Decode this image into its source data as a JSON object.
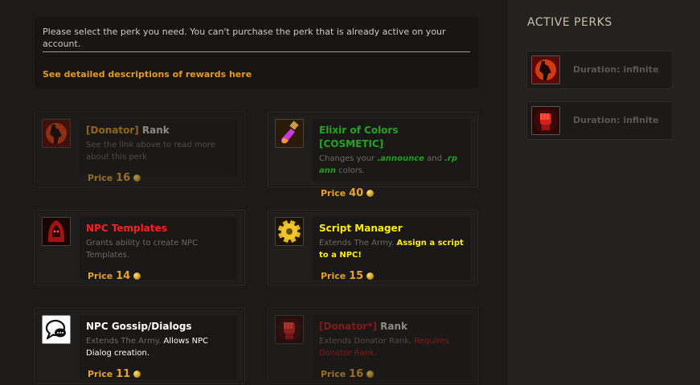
{
  "notice": {
    "text": "Please select the perk you need. You can't purchase the perk that is already active on your account.",
    "link": "See detailed descriptions of rewards here"
  },
  "perks": [
    {
      "title_parts": [
        "[Donator]",
        " Rank"
      ],
      "desc": "See the link above to read more about this perk",
      "price_label": "Price",
      "price": "16",
      "icon": "donator-silhouette-icon"
    },
    {
      "title_parts": [
        "Elixir of Colors",
        "[COSMETIC]"
      ],
      "desc_parts": [
        "Changes your ",
        ".announce",
        " and ",
        ".rp ann",
        " colors."
      ],
      "price_label": "Price",
      "price": "40",
      "icon": "potion-vial-icon"
    },
    {
      "title": "NPC Templates",
      "desc": "Grants ability to create NPC Templates.",
      "price_label": "Price",
      "price": "14",
      "icon": "hooded-figure-icon"
    },
    {
      "title": "Script Manager",
      "desc_parts": [
        "Extends The Army. ",
        "Assign a script to a NPC!"
      ],
      "price_label": "Price",
      "price": "15",
      "icon": "gear-icon"
    },
    {
      "title": "NPC Gossip/Dialogs",
      "desc_parts": [
        "Extends The Army. ",
        "Allows NPC Dialog creation."
      ],
      "price_label": "Price",
      "price": "11",
      "icon": "speech-bubble-icon"
    },
    {
      "title_parts": [
        "[Donator*]",
        " Rank"
      ],
      "desc_parts": [
        "Extends Donator Rank. ",
        "Requires Donator Rank."
      ],
      "price_label": "Price",
      "price": "16",
      "icon": "red-fist-icon"
    }
  ],
  "sidebar": {
    "title": "ACTIVE PERKS",
    "active": [
      {
        "duration": "Duration: infinite",
        "icon": "donator-silhouette-icon"
      },
      {
        "duration": "Duration: infinite",
        "icon": "red-fist-icon"
      }
    ]
  },
  "colors": {
    "accent": "#e29a22",
    "green": "#22a51e",
    "red": "#ff2020",
    "yellow": "#ffee00",
    "dark_red": "#b01818"
  }
}
